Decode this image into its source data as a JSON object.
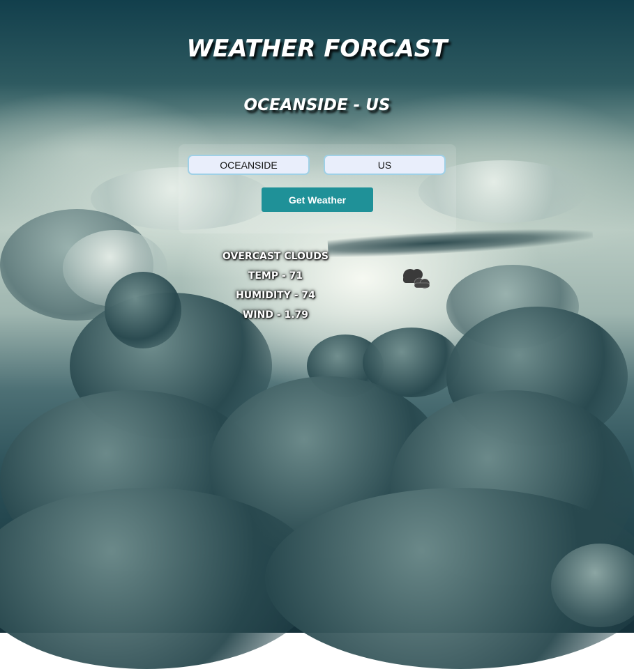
{
  "header": {
    "title": "WEATHER FORCAST",
    "location": "OCEANSIDE - US"
  },
  "form": {
    "city_value": "OCEANSIDE",
    "country_value": "US",
    "submit_label": "Get Weather"
  },
  "results": {
    "description": "OVERCAST CLOUDS",
    "temp": "TEMP - 71",
    "humidity": "HUMIDITY - 74",
    "wind": "WIND - 1.79",
    "icon": "overcast-clouds-icon"
  },
  "colors": {
    "button": "#1f9198",
    "input_background": "#e9eefb",
    "input_border": "#9fd0e6",
    "heading_text": "#ffffff"
  }
}
